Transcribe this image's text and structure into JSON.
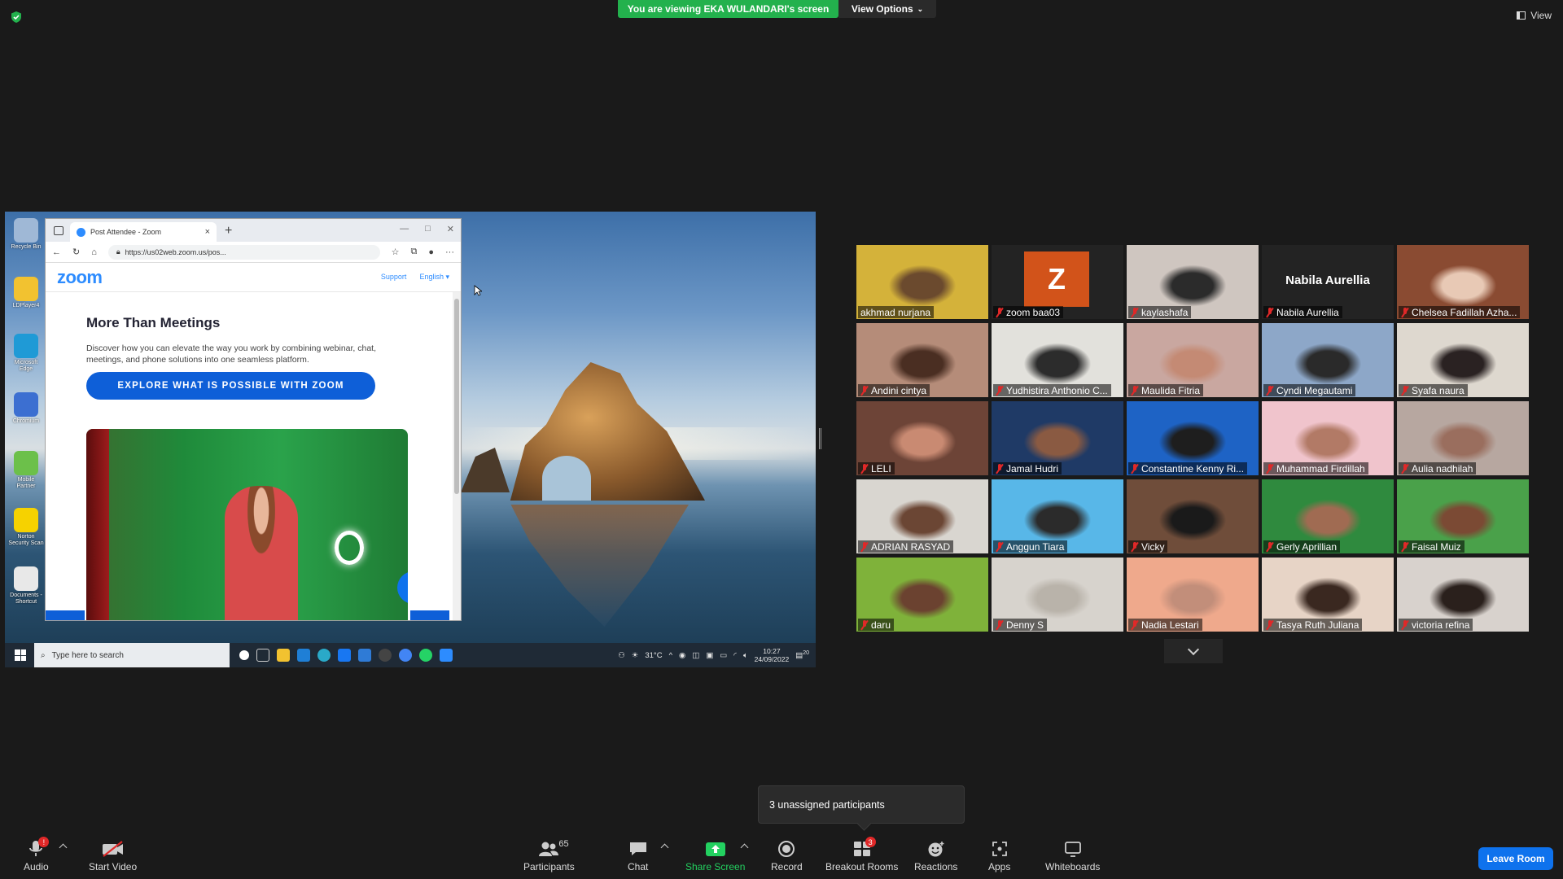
{
  "top": {
    "banner_text": "You are viewing EKA WULANDARI's screen",
    "view_options_label": "View Options",
    "view_label": "View"
  },
  "shared_screen": {
    "desktop_icons": [
      {
        "label": "Recycle Bin",
        "color": "#9fb8d6"
      },
      {
        "label": "LDPlayer4",
        "color": "#f2c230"
      },
      {
        "label": "Microsoft Edge",
        "color": "#1f9ad6"
      },
      {
        "label": "Chromium",
        "color": "#3c6fd1"
      },
      {
        "label": "Mobile Partner",
        "color": "#6cc04a"
      },
      {
        "label": "Norton Security Scan",
        "color": "#f6d200"
      },
      {
        "label": "Documents - Shortcut",
        "color": "#e8e8e8"
      }
    ],
    "browser": {
      "tab_title": "Post Attendee - Zoom",
      "url": "https://us02web.zoom.us/pos...",
      "logo": "zoom",
      "nav_support": "Support",
      "nav_language": "English",
      "heading": "More Than Meetings",
      "paragraph": "Discover how you can elevate the way you work by combining webinar, chat, meetings, and phone solutions into one seamless platform.",
      "cta": "EXPLORE WHAT IS POSSIBLE WITH ZOOM"
    },
    "taskbar": {
      "search_placeholder": "Type here to search",
      "weather": "31°C",
      "time": "10:27",
      "date": "24/09/2022",
      "notification_count": "20"
    }
  },
  "gallery": {
    "active_index": 0,
    "participants": [
      {
        "name": "akhmad nurjana",
        "muted": false,
        "bg": "#d4b23a",
        "skin": "#6b4a2e"
      },
      {
        "name": "zoom baa03",
        "muted": true,
        "initial": "Z"
      },
      {
        "name": "kaylashafa",
        "muted": true,
        "bg": "#cfc6c0",
        "skin": "#2b2b2b"
      },
      {
        "name": "Nabila Aurellia",
        "muted": true,
        "text_only": true,
        "display": "Nabila Aurellia"
      },
      {
        "name": "Chelsea Fadillah Azha...",
        "muted": true,
        "bg": "#8a4b32",
        "skin": "#e8c9b5"
      },
      {
        "name": "Andini cintya",
        "muted": true,
        "bg": "#b58c79",
        "skin": "#4a2e22"
      },
      {
        "name": "Yudhistira Anthonio C...",
        "muted": true,
        "bg": "#e2e1dc",
        "skin": "#2c2c2c"
      },
      {
        "name": "Maulida Fitria",
        "muted": true,
        "bg": "#c9a7a0",
        "skin": "#c48a74"
      },
      {
        "name": "Cyndi Megautami",
        "muted": true,
        "bg": "#8da7c8",
        "skin": "#2a2a2a"
      },
      {
        "name": "Syafa naura",
        "muted": true,
        "bg": "#ded8cf",
        "skin": "#2a2222"
      },
      {
        "name": "LELI",
        "muted": true,
        "bg": "#6d4437",
        "skin": "#c98a72"
      },
      {
        "name": "Jamal Hudri",
        "muted": true,
        "bg": "#1f3a66",
        "skin": "#8a5a42"
      },
      {
        "name": "Constantine Kenny Ri...",
        "muted": true,
        "bg": "#1e63c5",
        "skin": "#1e1e1e"
      },
      {
        "name": "Muhammad Firdillah",
        "muted": true,
        "bg": "#f0c4cc",
        "skin": "#b27a66"
      },
      {
        "name": "Aulia nadhilah",
        "muted": true,
        "bg": "#b7a7a0",
        "skin": "#9a6e5e"
      },
      {
        "name": "ADRIAN RASYAD",
        "muted": true,
        "bg": "#d9d6d0",
        "skin": "#6b4634"
      },
      {
        "name": "Anggun Tiara",
        "muted": true,
        "bg": "#58b7e8",
        "skin": "#2b2b2b"
      },
      {
        "name": "Vicky",
        "muted": true,
        "bg": "#6f4d3a",
        "skin": "#1a1a1a"
      },
      {
        "name": "Gerly Aprillian",
        "muted": true,
        "bg": "#2f8a3e",
        "skin": "#a06b52"
      },
      {
        "name": "Faisal Muiz",
        "muted": true,
        "bg": "#4aa14a",
        "skin": "#7b4a34"
      },
      {
        "name": "daru",
        "muted": true,
        "bg": "#7fb23a",
        "skin": "#6b4230"
      },
      {
        "name": "Denny S",
        "muted": true,
        "bg": "#d7d3cd",
        "skin": "#b9b3aa"
      },
      {
        "name": "Nadia Lestari",
        "muted": true,
        "bg": "#efa98c",
        "skin": "#c28e7a"
      },
      {
        "name": "Tasya Ruth Juliana",
        "muted": true,
        "bg": "#e7d4c6",
        "skin": "#3a2820"
      },
      {
        "name": "victoria refina",
        "muted": true,
        "bg": "#d8d2cd",
        "skin": "#2a201c"
      }
    ]
  },
  "tooltip": {
    "text": "3 unassigned participants"
  },
  "toolbar": {
    "audio": "Audio",
    "audio_badge": "!",
    "start_video": "Start Video",
    "participants": "Participants",
    "participants_count": "65",
    "chat": "Chat",
    "share_screen": "Share Screen",
    "record": "Record",
    "breakout_rooms": "Breakout Rooms",
    "breakout_badge": "3",
    "reactions": "Reactions",
    "apps": "Apps",
    "whiteboards": "Whiteboards",
    "leave": "Leave Room"
  },
  "colors": {
    "accent_green": "#23b14d",
    "leave_blue": "#0e72ed",
    "active_speaker": "#c6e44b",
    "mute_red": "#e02828"
  }
}
